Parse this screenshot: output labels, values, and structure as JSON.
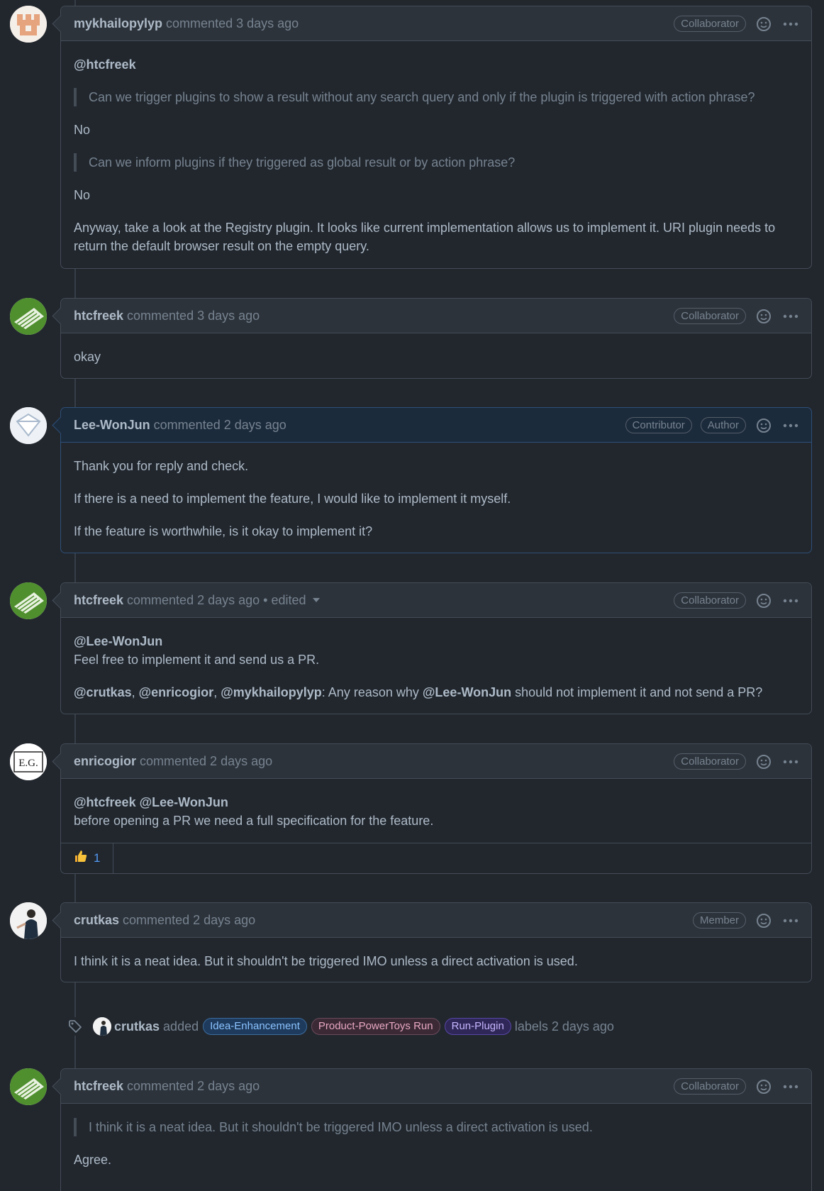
{
  "comments": [
    {
      "user": "mykhailopylyp",
      "meta": "commented 3 days ago",
      "badges": [
        "Collaborator"
      ],
      "mention": "@htcfreek",
      "quote1": "Can we trigger plugins to show a result without any search query and only if the plugin is triggered with action phrase?",
      "answer1": "No",
      "quote2": "Can we inform plugins if they triggered as global result or by action phrase?",
      "answer2": "No",
      "paragraph": "Anyway, take a look at the Registry plugin. It looks like current implementation allows us to implement it. URI plugin needs to return the default browser result on the empty query."
    },
    {
      "user": "htcfreek",
      "meta": "commented 3 days ago",
      "badges": [
        "Collaborator"
      ],
      "text": "okay"
    },
    {
      "user": "Lee-WonJun",
      "meta": "commented 2 days ago",
      "badges": [
        "Contributor",
        "Author"
      ],
      "p1": "Thank you for reply and check.",
      "p2": "If there is a need to implement the feature, I would like to implement it myself.",
      "p3": "If the feature is worthwhile, is it okay to implement it?"
    },
    {
      "user": "htcfreek",
      "meta": "commented 2 days ago",
      "edited": "• edited",
      "badges": [
        "Collaborator"
      ],
      "mention": "@Lee-WonJun",
      "line1": "Feel free to implement it and send us a PR.",
      "m1": "@crutkas",
      "sep1": ", ",
      "m2": "@enricogior",
      "sep2": ", ",
      "m3": "@mykhailopylyp",
      "mid": ": Any reason why ",
      "m4": "@Lee-WonJun",
      "tail": " should not implement it and not send a PR?"
    },
    {
      "user": "enricogior",
      "meta": "commented 2 days ago",
      "badges": [
        "Collaborator"
      ],
      "m1": "@htcfreek",
      "m2": "@Lee-WonJun",
      "line1": "before opening a PR we need a full specification for the feature.",
      "reaction_count": "1"
    },
    {
      "user": "crutkas",
      "meta": "commented 2 days ago",
      "badges": [
        "Member"
      ],
      "text": "I think it is a neat idea. But it shouldn't be triggered IMO unless a direct activation is used."
    },
    {
      "user": "htcfreek",
      "meta": "commented 2 days ago",
      "badges": [
        "Collaborator"
      ],
      "quote": "I think it is a neat idea. But it shouldn't be triggered IMO unless a direct activation is used.",
      "text": "Agree."
    }
  ],
  "label_event": {
    "user": "crutkas",
    "action": "added",
    "labels": [
      "Idea-Enhancement",
      "Product-PowerToys Run",
      "Run-Plugin"
    ],
    "suffix": "labels 2 days ago"
  },
  "avatar_initials": "E.G.",
  "icons": {
    "smiley": "smiley-icon",
    "kebab": "kebab-menu-icon",
    "tag": "tag-icon",
    "thumbsup": "thumbs-up-icon"
  },
  "colors": {
    "background": "#22272e",
    "header": "#2d333b",
    "author_header": "#1c2b3c",
    "link": "#539bf5"
  }
}
